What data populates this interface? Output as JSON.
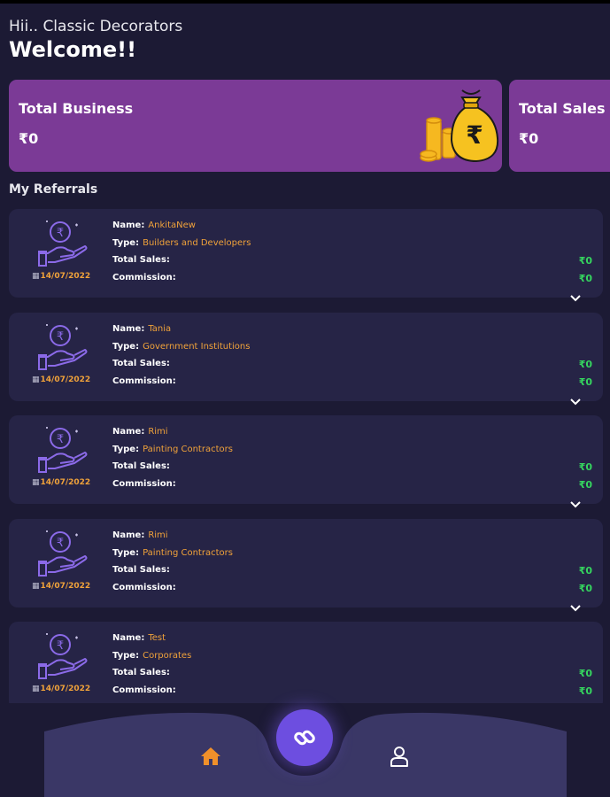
{
  "header": {
    "greeting": "Hii.. Classic Decorators",
    "welcome": "Welcome!!"
  },
  "summary_cards": [
    {
      "title": "Total Business",
      "value": "₹0",
      "icon": "money-bag-icon"
    },
    {
      "title": "Total Sales",
      "value": "₹0"
    }
  ],
  "section_title": "My Referrals",
  "labels": {
    "name": "Name:",
    "type": "Type:",
    "total_sales": "Total Sales:",
    "commission": "Commission:"
  },
  "referrals": [
    {
      "date": "14/07/2022",
      "name": "AnkitaNew",
      "type": "Builders and Developers",
      "total_sales": "₹0",
      "commission": "₹0"
    },
    {
      "date": "14/07/2022",
      "name": "Tania",
      "type": "Government Institutions",
      "total_sales": "₹0",
      "commission": "₹0"
    },
    {
      "date": "14/07/2022",
      "name": "Rimi",
      "type": "Painting Contractors",
      "total_sales": "₹0",
      "commission": "₹0"
    },
    {
      "date": "14/07/2022",
      "name": "Rimi",
      "type": "Painting Contractors",
      "total_sales": "₹0",
      "commission": "₹0"
    },
    {
      "date": "14/07/2022",
      "name": "Test",
      "type": "Corporates",
      "total_sales": "₹0",
      "commission": "₹0"
    }
  ],
  "nav": {
    "items": [
      "home-icon",
      "link-icon",
      "user-icon"
    ],
    "active": "home-icon"
  },
  "colors": {
    "background": "#1c1a34",
    "card": "#262446",
    "summary_card": "#7b3a96",
    "accent_orange": "#f0a23a",
    "accent_green": "#35d45f",
    "fab": "#6d4ee0",
    "nav_bar": "#3a3766"
  }
}
